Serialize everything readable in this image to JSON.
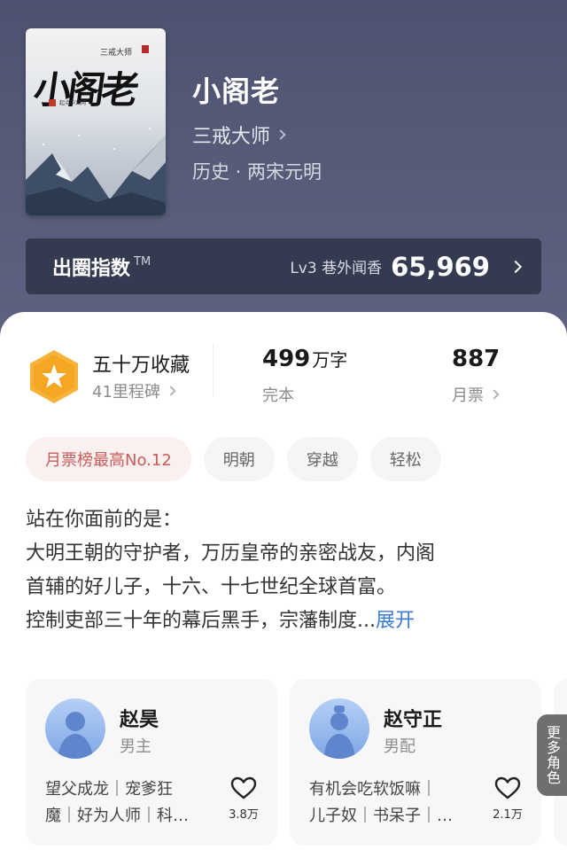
{
  "book": {
    "title": "小阁老",
    "author": "三戒大师",
    "genre": "历史 · 两宋元明",
    "cover": {
      "title_text": "小阁老",
      "author_text": "三戒大师",
      "publisher_text": "起点中文网"
    }
  },
  "index_bar": {
    "label": "出圈指数",
    "tm": "TM",
    "level": "Lv3 巷外闻香",
    "value": "65,969"
  },
  "stats": {
    "collection": {
      "title": "五十万收藏",
      "sub": "41里程碑"
    },
    "words": {
      "number": "499",
      "unit": "万字",
      "sub": "完本"
    },
    "tickets": {
      "number": "887",
      "sub": "月票"
    }
  },
  "tags": [
    "月票榜最高No.12",
    "明朝",
    "穿越",
    "轻松"
  ],
  "synopsis": {
    "lines": [
      "站在你面前的是：",
      "大明王朝的守护者，万历皇帝的亲密战友，内阁",
      "首辅的好儿子，十六、十七世纪全球首富。",
      "控制吏部三十年的幕后黑手，宗藩制度..."
    ],
    "expand": "展开"
  },
  "roles": [
    {
      "name": "赵昊",
      "type": "男主",
      "desc_lines": [
        "望父成龙｜宠爹狂",
        "魔｜好为人师｜科…"
      ],
      "likes": "3.8万"
    },
    {
      "name": "赵守正",
      "type": "男配",
      "desc_lines": [
        "有机会吃软饭嘛｜",
        "儿子奴｜书呆子｜…"
      ],
      "likes": "2.1万"
    }
  ],
  "more_roles": "更多角色",
  "colors": {
    "hero_bg": "#565b78",
    "index_bar_bg": "#343a4f",
    "badge": "#f7b23b",
    "link": "#3a7bd5",
    "rank_tag": "#c75c5c"
  }
}
